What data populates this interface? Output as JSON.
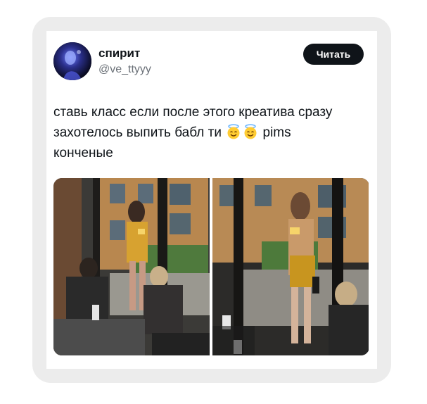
{
  "tweet": {
    "author": {
      "display_name": "спирит",
      "handle": "@ve_ttyyy",
      "avatar_icon": "avatar-photo"
    },
    "follow_label": "Читать",
    "text_line1": "ставь класс если после этого креатива сразу",
    "text_line2_before": "захотелось выпить бабл ти",
    "emojis": [
      "smiling-face-with-halo",
      "smiling-face-with-halo"
    ],
    "text_line2_after": "pims",
    "text_line3": "конченые",
    "media": [
      {
        "kind": "photo",
        "description_icon": "photo-cafe-window"
      },
      {
        "kind": "photo",
        "description_icon": "photo-cafe-window"
      }
    ]
  },
  "colors": {
    "frame": "#ececec",
    "card": "#ffffff",
    "text": "#0f1419",
    "muted": "#6b7178",
    "button": "#0f1419"
  }
}
